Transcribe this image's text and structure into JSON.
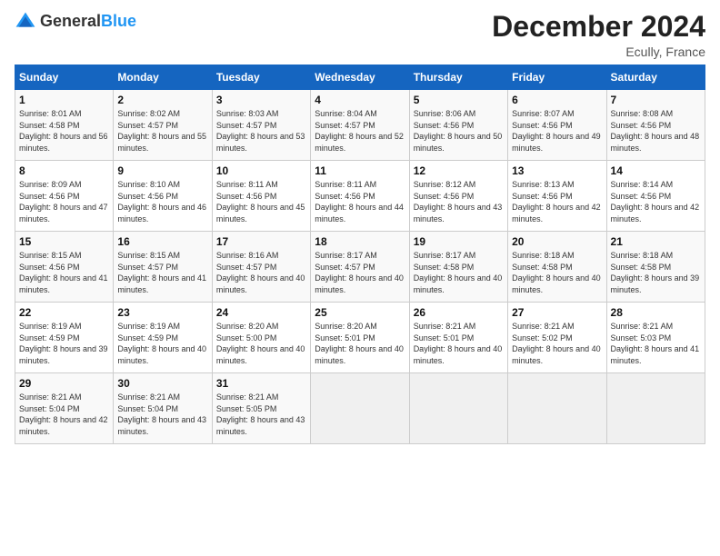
{
  "header": {
    "logo_general": "General",
    "logo_blue": "Blue",
    "title": "December 2024",
    "subtitle": "Ecully, France"
  },
  "days_of_week": [
    "Sunday",
    "Monday",
    "Tuesday",
    "Wednesday",
    "Thursday",
    "Friday",
    "Saturday"
  ],
  "weeks": [
    [
      {
        "day": "1",
        "sunrise": "8:01 AM",
        "sunset": "4:58 PM",
        "daylight": "8 hours and 56 minutes."
      },
      {
        "day": "2",
        "sunrise": "8:02 AM",
        "sunset": "4:57 PM",
        "daylight": "8 hours and 55 minutes."
      },
      {
        "day": "3",
        "sunrise": "8:03 AM",
        "sunset": "4:57 PM",
        "daylight": "8 hours and 53 minutes."
      },
      {
        "day": "4",
        "sunrise": "8:04 AM",
        "sunset": "4:57 PM",
        "daylight": "8 hours and 52 minutes."
      },
      {
        "day": "5",
        "sunrise": "8:06 AM",
        "sunset": "4:56 PM",
        "daylight": "8 hours and 50 minutes."
      },
      {
        "day": "6",
        "sunrise": "8:07 AM",
        "sunset": "4:56 PM",
        "daylight": "8 hours and 49 minutes."
      },
      {
        "day": "7",
        "sunrise": "8:08 AM",
        "sunset": "4:56 PM",
        "daylight": "8 hours and 48 minutes."
      }
    ],
    [
      {
        "day": "8",
        "sunrise": "8:09 AM",
        "sunset": "4:56 PM",
        "daylight": "8 hours and 47 minutes."
      },
      {
        "day": "9",
        "sunrise": "8:10 AM",
        "sunset": "4:56 PM",
        "daylight": "8 hours and 46 minutes."
      },
      {
        "day": "10",
        "sunrise": "8:11 AM",
        "sunset": "4:56 PM",
        "daylight": "8 hours and 45 minutes."
      },
      {
        "day": "11",
        "sunrise": "8:11 AM",
        "sunset": "4:56 PM",
        "daylight": "8 hours and 44 minutes."
      },
      {
        "day": "12",
        "sunrise": "8:12 AM",
        "sunset": "4:56 PM",
        "daylight": "8 hours and 43 minutes."
      },
      {
        "day": "13",
        "sunrise": "8:13 AM",
        "sunset": "4:56 PM",
        "daylight": "8 hours and 42 minutes."
      },
      {
        "day": "14",
        "sunrise": "8:14 AM",
        "sunset": "4:56 PM",
        "daylight": "8 hours and 42 minutes."
      }
    ],
    [
      {
        "day": "15",
        "sunrise": "8:15 AM",
        "sunset": "4:56 PM",
        "daylight": "8 hours and 41 minutes."
      },
      {
        "day": "16",
        "sunrise": "8:15 AM",
        "sunset": "4:57 PM",
        "daylight": "8 hours and 41 minutes."
      },
      {
        "day": "17",
        "sunrise": "8:16 AM",
        "sunset": "4:57 PM",
        "daylight": "8 hours and 40 minutes."
      },
      {
        "day": "18",
        "sunrise": "8:17 AM",
        "sunset": "4:57 PM",
        "daylight": "8 hours and 40 minutes."
      },
      {
        "day": "19",
        "sunrise": "8:17 AM",
        "sunset": "4:58 PM",
        "daylight": "8 hours and 40 minutes."
      },
      {
        "day": "20",
        "sunrise": "8:18 AM",
        "sunset": "4:58 PM",
        "daylight": "8 hours and 40 minutes."
      },
      {
        "day": "21",
        "sunrise": "8:18 AM",
        "sunset": "4:58 PM",
        "daylight": "8 hours and 39 minutes."
      }
    ],
    [
      {
        "day": "22",
        "sunrise": "8:19 AM",
        "sunset": "4:59 PM",
        "daylight": "8 hours and 39 minutes."
      },
      {
        "day": "23",
        "sunrise": "8:19 AM",
        "sunset": "4:59 PM",
        "daylight": "8 hours and 40 minutes."
      },
      {
        "day": "24",
        "sunrise": "8:20 AM",
        "sunset": "5:00 PM",
        "daylight": "8 hours and 40 minutes."
      },
      {
        "day": "25",
        "sunrise": "8:20 AM",
        "sunset": "5:01 PM",
        "daylight": "8 hours and 40 minutes."
      },
      {
        "day": "26",
        "sunrise": "8:21 AM",
        "sunset": "5:01 PM",
        "daylight": "8 hours and 40 minutes."
      },
      {
        "day": "27",
        "sunrise": "8:21 AM",
        "sunset": "5:02 PM",
        "daylight": "8 hours and 40 minutes."
      },
      {
        "day": "28",
        "sunrise": "8:21 AM",
        "sunset": "5:03 PM",
        "daylight": "8 hours and 41 minutes."
      }
    ],
    [
      {
        "day": "29",
        "sunrise": "8:21 AM",
        "sunset": "5:04 PM",
        "daylight": "8 hours and 42 minutes."
      },
      {
        "day": "30",
        "sunrise": "8:21 AM",
        "sunset": "5:04 PM",
        "daylight": "8 hours and 43 minutes."
      },
      {
        "day": "31",
        "sunrise": "8:21 AM",
        "sunset": "5:05 PM",
        "daylight": "8 hours and 43 minutes."
      },
      null,
      null,
      null,
      null
    ]
  ]
}
